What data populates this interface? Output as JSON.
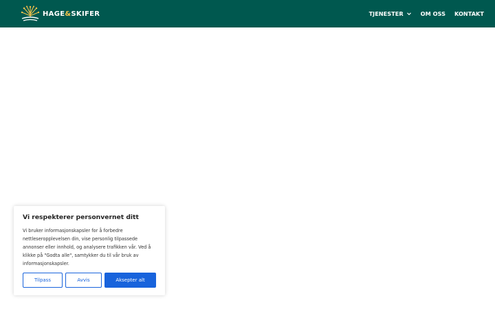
{
  "header": {
    "brand_part1": "HAGE",
    "brand_amp": "&",
    "brand_part2": "SKIFER",
    "bg_color": "#00584f",
    "nav": [
      {
        "label": "TJENESTER",
        "has_dropdown": true
      },
      {
        "label": "OM OSS"
      },
      {
        "label": "KONTAKT"
      }
    ]
  },
  "consent": {
    "title": "Vi respekterer personvernet ditt",
    "body": "Vi bruker informasjonskapsler for å forbedre nettleseropplevelsen din, vise personlig tilpassede annonser eller innhold, og analysere trafikken vår. Ved å klikke på \"Godta alle\", samtykker du til vår bruk av informasjonskapsler.",
    "buttons": {
      "customize": "Tilpass",
      "reject": "Avvis",
      "accept": "Aksepter alt"
    },
    "accent_color": "#1863dc"
  }
}
